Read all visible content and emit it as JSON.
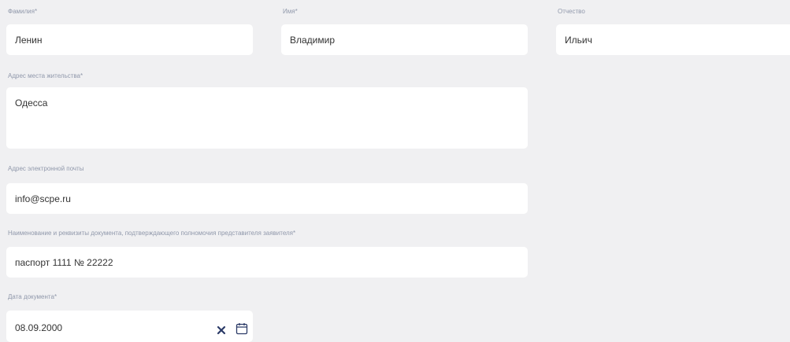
{
  "form": {
    "last_name": {
      "label": "Фамилия*",
      "value": "Ленин"
    },
    "first_name": {
      "label": "Имя*",
      "value": "Владимир"
    },
    "patronymic": {
      "label": "Отчество",
      "value": "Ильич"
    },
    "address": {
      "label": "Адрес места жительства*",
      "value": "Одесса"
    },
    "email": {
      "label": "Адрес электронной почты",
      "value": "info@scpe.ru"
    },
    "document": {
      "label": "Наименование и реквизиты документа, подтверждающего полномочия представителя заявителя*",
      "value": "паспорт 1111 № 22222"
    },
    "document_date": {
      "label": "Дата документа*",
      "value": "08.09.2000",
      "clear_icon": "clear-x-icon",
      "calendar_icon": "calendar-icon"
    }
  },
  "colors": {
    "background": "#f0f0f2",
    "field_background": "#ffffff",
    "label": "#9098ab",
    "text": "#333333",
    "icon": "#2b3a67"
  }
}
